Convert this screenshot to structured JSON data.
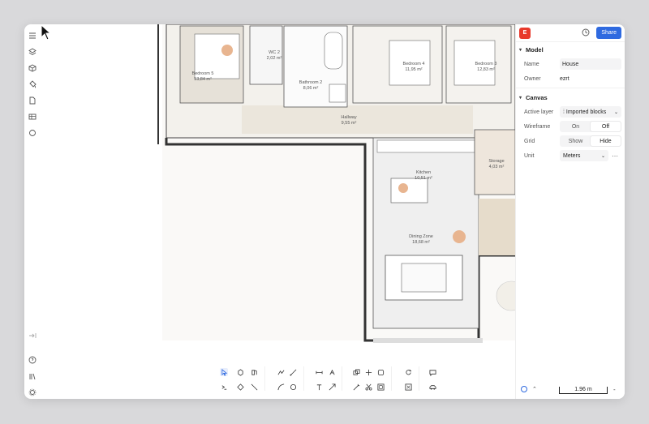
{
  "user": {
    "initial": "E"
  },
  "header": {
    "share_label": "Share"
  },
  "model": {
    "section_label": "Model",
    "name_label": "Name",
    "name_value": "House",
    "owner_label": "Owner",
    "owner_value": "ezrt"
  },
  "canvas_props": {
    "section_label": "Canvas",
    "active_layer_label": "Active layer",
    "active_layer_value": "Imported blocks",
    "wireframe_label": "Wireframe",
    "wireframe_on": "On",
    "wireframe_off": "Off",
    "grid_label": "Grid",
    "grid_show": "Show",
    "grid_hide": "Hide",
    "unit_label": "Unit",
    "unit_value": "Meters"
  },
  "rooms": [
    {
      "name": "Bedroom 5",
      "area": "13,84 m²"
    },
    {
      "name": "WC 2",
      "area": "2,02 m²"
    },
    {
      "name": "Bathroom 2",
      "area": "8,06 m²"
    },
    {
      "name": "Bedroom 4",
      "area": "11,95 m²"
    },
    {
      "name": "Bedroom 3",
      "area": "12,83 m²"
    },
    {
      "name": "Hallway",
      "area": "9,55 m²"
    },
    {
      "name": "Kitchen",
      "area": "10,51 m²"
    },
    {
      "name": "Storage",
      "area": "4,03 m²"
    },
    {
      "name": "Dining Zone",
      "area": "18,68 m²"
    }
  ],
  "status": {
    "scale_label": "1.96 m",
    "minus": "-"
  },
  "colors": {
    "accent": "#2f6ae0",
    "avatar": "#e8392b"
  }
}
